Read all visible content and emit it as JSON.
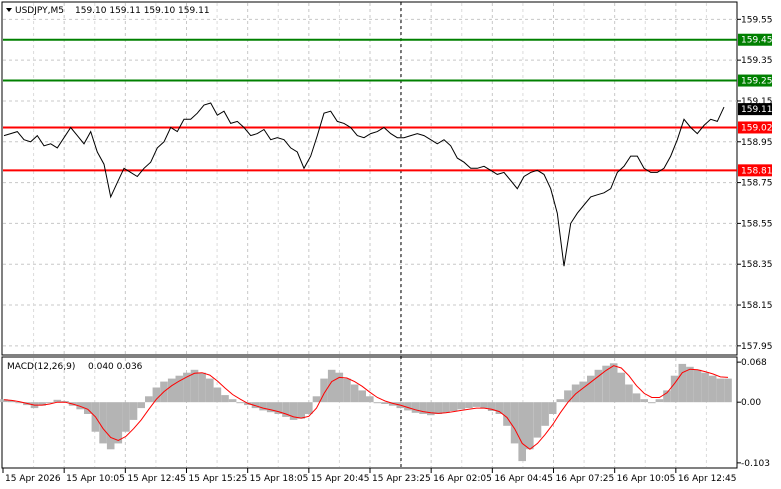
{
  "chart_data": {
    "type": "line",
    "symbol": "USDJPY,M5",
    "ohlc_text": "159.10 159.11 159.10 159.11",
    "current_price": "159.11",
    "price_ticks": [
      "159.55",
      "159.35",
      "159.15",
      "158.95",
      "158.75",
      "158.55",
      "158.35",
      "158.15",
      "157.95"
    ],
    "price_range": [
      157.91,
      159.63
    ],
    "levels": [
      {
        "label": "159.45",
        "value": 159.45,
        "color": "#008000"
      },
      {
        "label": "159.25",
        "value": 159.25,
        "color": "#008000"
      },
      {
        "label": "159.02",
        "value": 159.02,
        "color": "#ff0000"
      },
      {
        "label": "158.81",
        "value": 158.81,
        "color": "#ff0000"
      }
    ],
    "time_labels": [
      "15 Apr 2026",
      "15 Apr 10:05",
      "15 Apr 12:45",
      "15 Apr 15:25",
      "15 Apr 18:05",
      "15 Apr 20:45",
      "15 Apr 23:25",
      "16 Apr 02:05",
      "16 Apr 04:45",
      "16 Apr 07:25",
      "16 Apr 10:05",
      "16 Apr 12:45"
    ],
    "price_series": [
      158.98,
      158.99,
      159.0,
      158.96,
      158.95,
      158.98,
      158.93,
      158.94,
      158.92,
      158.97,
      159.02,
      158.98,
      158.94,
      159.0,
      158.9,
      158.84,
      158.68,
      158.75,
      158.82,
      158.8,
      158.78,
      158.82,
      158.85,
      158.92,
      158.95,
      159.02,
      159.0,
      159.06,
      159.06,
      159.09,
      159.13,
      159.14,
      159.08,
      159.1,
      159.04,
      159.05,
      159.02,
      158.98,
      158.99,
      159.01,
      158.96,
      158.97,
      158.96,
      158.92,
      158.9,
      158.82,
      158.88,
      158.98,
      159.09,
      159.1,
      159.05,
      159.04,
      159.02,
      158.98,
      158.97,
      158.99,
      159.0,
      159.02,
      158.99,
      158.97,
      158.97,
      158.98,
      158.99,
      158.98,
      158.96,
      158.94,
      158.96,
      158.93,
      158.87,
      158.85,
      158.82,
      158.82,
      158.83,
      158.81,
      158.79,
      158.8,
      158.76,
      158.72,
      158.78,
      158.8,
      158.81,
      158.79,
      158.72,
      158.6,
      158.34,
      158.55,
      158.6,
      158.64,
      158.68,
      158.69,
      158.7,
      158.72,
      158.8,
      158.83,
      158.88,
      158.88,
      158.82,
      158.8,
      158.8,
      158.82,
      158.88,
      158.96,
      159.06,
      159.02,
      158.99,
      159.03,
      159.06,
      159.05,
      159.12
    ],
    "macd_label": "MACD(12,26,9)",
    "macd_values_text": "0.040 0.036",
    "macd_ticks": [
      "0.068",
      "0.00",
      "-0.103"
    ],
    "macd_range": [
      -0.11,
      0.075
    ],
    "macd_histogram": [
      0.005,
      0.003,
      0.0,
      -0.005,
      -0.01,
      -0.006,
      0.0,
      0.004,
      0.002,
      -0.006,
      -0.012,
      -0.02,
      -0.05,
      -0.07,
      -0.08,
      -0.07,
      -0.05,
      -0.03,
      -0.01,
      0.01,
      0.025,
      0.035,
      0.04,
      0.045,
      0.05,
      0.055,
      0.05,
      0.04,
      0.025,
      0.012,
      0.005,
      0.0,
      -0.005,
      -0.01,
      -0.014,
      -0.017,
      -0.02,
      -0.025,
      -0.03,
      -0.028,
      -0.02,
      0.01,
      0.04,
      0.055,
      0.05,
      0.04,
      0.03,
      0.02,
      0.01,
      0.0,
      -0.003,
      -0.006,
      -0.01,
      -0.014,
      -0.018,
      -0.02,
      -0.022,
      -0.02,
      -0.018,
      -0.015,
      -0.012,
      -0.01,
      -0.008,
      -0.01,
      -0.015,
      -0.02,
      -0.04,
      -0.07,
      -0.1,
      -0.08,
      -0.06,
      -0.04,
      -0.02,
      0.005,
      0.02,
      0.03,
      0.035,
      0.045,
      0.055,
      0.062,
      0.066,
      0.05,
      0.03,
      0.015,
      0.005,
      0.0,
      0.005,
      0.02,
      0.045,
      0.065,
      0.06,
      0.055,
      0.05,
      0.045,
      0.04,
      0.04
    ],
    "macd_signal": [
      0.004,
      0.003,
      0.001,
      -0.002,
      -0.005,
      -0.005,
      -0.003,
      0.0,
      0.0,
      -0.003,
      -0.007,
      -0.012,
      -0.025,
      -0.045,
      -0.06,
      -0.065,
      -0.058,
      -0.045,
      -0.03,
      -0.012,
      0.005,
      0.018,
      0.028,
      0.036,
      0.043,
      0.049,
      0.05,
      0.046,
      0.036,
      0.024,
      0.013,
      0.005,
      -0.002,
      -0.006,
      -0.01,
      -0.013,
      -0.016,
      -0.02,
      -0.025,
      -0.027,
      -0.024,
      -0.01,
      0.015,
      0.035,
      0.042,
      0.041,
      0.035,
      0.027,
      0.017,
      0.008,
      0.002,
      -0.002,
      -0.005,
      -0.009,
      -0.013,
      -0.016,
      -0.018,
      -0.019,
      -0.018,
      -0.016,
      -0.014,
      -0.012,
      -0.01,
      -0.01,
      -0.012,
      -0.016,
      -0.026,
      -0.045,
      -0.07,
      -0.08,
      -0.07,
      -0.055,
      -0.038,
      -0.018,
      0.0,
      0.014,
      0.024,
      0.034,
      0.044,
      0.054,
      0.062,
      0.058,
      0.045,
      0.028,
      0.015,
      0.008,
      0.008,
      0.016,
      0.032,
      0.05,
      0.056,
      0.055,
      0.052,
      0.048,
      0.043,
      0.042
    ]
  }
}
